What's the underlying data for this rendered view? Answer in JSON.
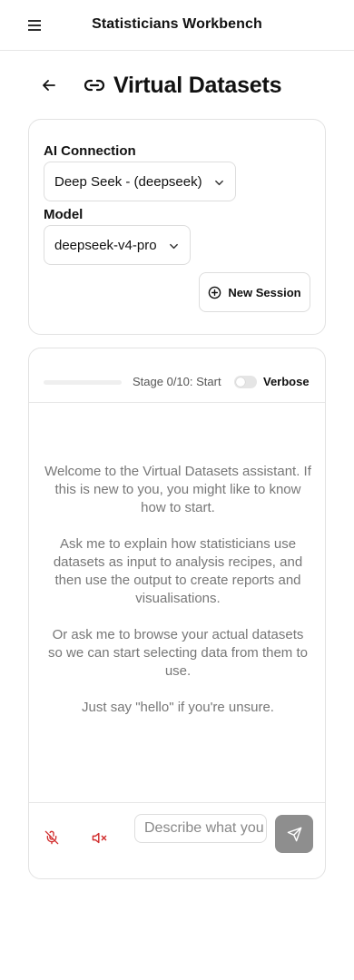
{
  "header": {
    "app_title": "Statisticians Workbench",
    "menu_icon": "hamburger-icon"
  },
  "page": {
    "title": "Virtual Datasets",
    "title_icon": "link-icon",
    "back_icon": "arrow-left-icon"
  },
  "settings": {
    "ai_connection_label": "AI Connection",
    "ai_connection_value": "Deep Seek - (deepseek)",
    "model_label": "Model",
    "model_value": "deepseek-v4-pro",
    "new_session_label": "New Session"
  },
  "chat": {
    "progress": 0,
    "stage_text": "Stage 0/10: Start",
    "verbose_label": "Verbose",
    "verbose_on": false,
    "messages": [
      "Welcome to the Virtual Datasets assistant. If this is new to you, you might like to know how to start.",
      "Ask me to explain how statisticians use datasets as input to analysis recipes, and then use the output to create reports and visualisations.",
      "Or ask me to browse your actual datasets so we can start selecting data from them to use.",
      "Just say \"hello\" if you're unsure."
    ],
    "input_placeholder": "Describe what you want",
    "input_value": ""
  },
  "colors": {
    "mic_off": "#d12c2c",
    "volume_off": "#d12c2c",
    "send_bg": "#8e8e8e",
    "border": "#e2e2e2"
  }
}
